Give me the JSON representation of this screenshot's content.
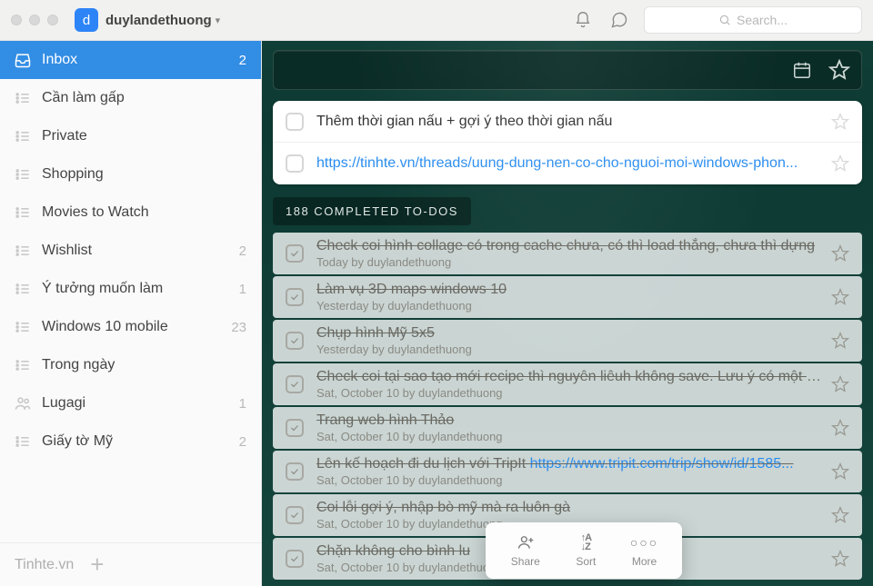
{
  "titlebar": {
    "avatar_initial": "d",
    "username": "duylandethuong",
    "search_placeholder": "Search..."
  },
  "sidebar": {
    "items": [
      {
        "label": "Inbox",
        "count": "2",
        "icon": "inbox",
        "active": true
      },
      {
        "label": "Cần làm gấp",
        "count": "",
        "icon": "list",
        "active": false
      },
      {
        "label": "Private",
        "count": "",
        "icon": "list",
        "active": false
      },
      {
        "label": "Shopping",
        "count": "",
        "icon": "list",
        "active": false
      },
      {
        "label": "Movies to Watch",
        "count": "",
        "icon": "list",
        "active": false
      },
      {
        "label": "Wishlist",
        "count": "2",
        "icon": "list",
        "active": false
      },
      {
        "label": "Ý tưởng muốn làm",
        "count": "1",
        "icon": "list",
        "active": false
      },
      {
        "label": "Windows 10 mobile",
        "count": "23",
        "icon": "list",
        "active": false
      },
      {
        "label": "Trong ngày",
        "count": "",
        "icon": "list",
        "active": false
      },
      {
        "label": "Lugagi",
        "count": "1",
        "icon": "people",
        "active": false
      },
      {
        "label": "Giấy tờ Mỹ",
        "count": "2",
        "icon": "list",
        "active": false
      }
    ],
    "footer_text": "Tinhte.vn"
  },
  "main": {
    "active_todos": [
      {
        "text": "Thêm thời gian nấu + gợi ý theo thời gian nấu",
        "is_link": false
      },
      {
        "text": "https://tinhte.vn/threads/uung-dung-nen-co-cho-nguoi-moi-windows-phon...",
        "is_link": true
      }
    ],
    "completed_header": "188 COMPLETED TO-DOS",
    "completed": [
      {
        "title": "Check coi hình collage có trong cache chưa, có thì load thẳng, chưa thì dựng",
        "meta": "Today by duylandethuong",
        "link": ""
      },
      {
        "title": "Làm vụ 3D maps windows 10",
        "meta": "Yesterday by duylandethuong",
        "link": ""
      },
      {
        "title": "Chụp hình Mỹ 5x5",
        "meta": "Yesterday by duylandethuong",
        "link": ""
      },
      {
        "title": "Check coi tại sao tạo mới recipe thì nguyên liêuh không save. Lưu ý có một t...",
        "meta": "Sat, October 10 by duylandethuong",
        "link": ""
      },
      {
        "title": "Trang web hình Thảo",
        "meta": "Sat, October 10 by duylandethuong",
        "link": ""
      },
      {
        "title": "Lên kế hoạch đi du lịch với TripIt ",
        "meta": "Sat, October 10 by duylandethuong",
        "link": "https://www.tripit.com/trip/show/id/1585..."
      },
      {
        "title": "Coi lỗi gợi ý, nhập bò mỹ mà ra luôn gà",
        "meta": "Sat, October 10 by duylandethuong",
        "link": ""
      },
      {
        "title": "Chặn không cho bình lu",
        "meta": "Sat, October 10 by duylandethuong",
        "link": ""
      }
    ],
    "actionbar": {
      "share": "Share",
      "sort": "Sort",
      "more": "More"
    }
  }
}
